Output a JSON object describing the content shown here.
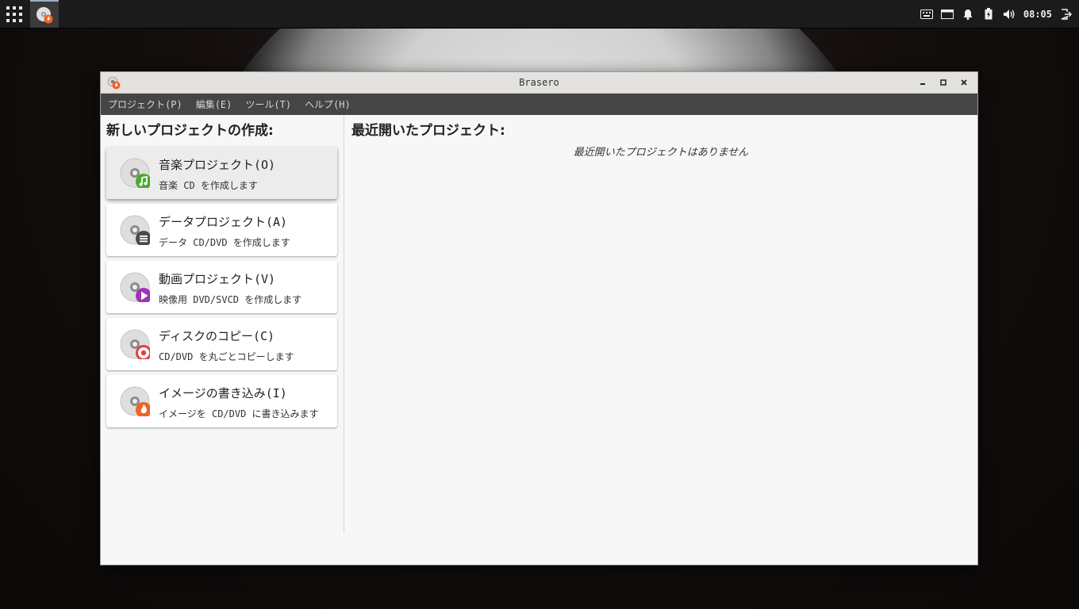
{
  "panel": {
    "clock": "08:05",
    "icons": [
      "apps-grid-icon",
      "brasero-icon",
      "keyboard-icon",
      "display-icon",
      "bell-icon",
      "battery-icon",
      "volume-icon",
      "logout-icon"
    ]
  },
  "window": {
    "title": "Brasero"
  },
  "menubar": {
    "items": [
      {
        "label": "プロジェクト(P)"
      },
      {
        "label": "編集(E)"
      },
      {
        "label": "ツール(T)"
      },
      {
        "label": "ヘルプ(H)"
      }
    ]
  },
  "left": {
    "heading": "新しいプロジェクトの作成:",
    "projects": [
      {
        "title": "音楽プロジェクト(O)",
        "desc": "音楽 CD を作成します",
        "badge_color": "#4aa82c",
        "badge_icon": "music-note-icon"
      },
      {
        "title": "データプロジェクト(A)",
        "desc": "データ CD/DVD を作成します",
        "badge_color": "#4a4a4a",
        "badge_icon": "list-icon"
      },
      {
        "title": "動画プロジェクト(V)",
        "desc": "映像用 DVD/SVCD を作成します",
        "badge_color": "#9c35b6",
        "badge_icon": "play-icon"
      },
      {
        "title": "ディスクのコピー(C)",
        "desc": "CD/DVD を丸ごとコピーします",
        "badge_color": "#e53b3b",
        "badge_icon": "target-icon"
      },
      {
        "title": "イメージの書き込み(I)",
        "desc": "イメージを CD/DVD に書き込みます",
        "badge_color": "#f06324",
        "badge_icon": "flame-icon"
      }
    ]
  },
  "right": {
    "heading": "最近開いたプロジェクト:",
    "empty_message": "最近開いたプロジェクトはありません"
  }
}
